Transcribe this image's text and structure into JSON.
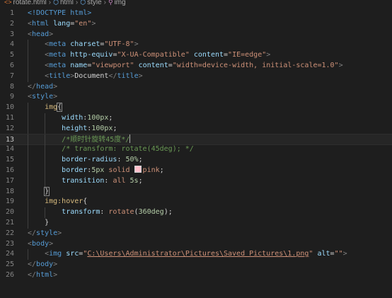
{
  "breadcrumb": [
    "rotate.html",
    "html",
    "style",
    "img"
  ],
  "lines": [
    {
      "n": "1",
      "tokens": [
        [
          "t-tag",
          "<!DOCTYPE html>"
        ]
      ]
    },
    {
      "n": "2",
      "tokens": [
        [
          "t-punc",
          "<"
        ],
        [
          "t-tag",
          "html "
        ],
        [
          "t-attr",
          "lang"
        ],
        [
          "t-txt",
          "="
        ],
        [
          "t-str",
          "\"en\""
        ],
        [
          "t-punc",
          ">"
        ]
      ]
    },
    {
      "n": "3",
      "tokens": [
        [
          "t-punc",
          "<"
        ],
        [
          "t-tag",
          "head"
        ],
        [
          "t-punc",
          ">"
        ]
      ]
    },
    {
      "n": "4",
      "indent": 2,
      "tokens": [
        [
          "t-punc",
          "<"
        ],
        [
          "t-tag",
          "meta "
        ],
        [
          "t-attr",
          "charset"
        ],
        [
          "t-txt",
          "="
        ],
        [
          "t-str",
          "\"UTF-8\""
        ],
        [
          "t-punc",
          ">"
        ]
      ]
    },
    {
      "n": "5",
      "indent": 2,
      "tokens": [
        [
          "t-punc",
          "<"
        ],
        [
          "t-tag",
          "meta "
        ],
        [
          "t-attr",
          "http-equiv"
        ],
        [
          "t-txt",
          "="
        ],
        [
          "t-str",
          "\"X-UA-Compatible\" "
        ],
        [
          "t-attr",
          "content"
        ],
        [
          "t-txt",
          "="
        ],
        [
          "t-str",
          "\"IE=edge\""
        ],
        [
          "t-punc",
          ">"
        ]
      ]
    },
    {
      "n": "6",
      "indent": 2,
      "tokens": [
        [
          "t-punc",
          "<"
        ],
        [
          "t-tag",
          "meta "
        ],
        [
          "t-attr",
          "name"
        ],
        [
          "t-txt",
          "="
        ],
        [
          "t-str",
          "\"viewport\" "
        ],
        [
          "t-attr",
          "content"
        ],
        [
          "t-txt",
          "="
        ],
        [
          "t-str",
          "\"width=device-width, initial-scale=1.0\""
        ],
        [
          "t-punc",
          ">"
        ]
      ]
    },
    {
      "n": "7",
      "indent": 2,
      "tokens": [
        [
          "t-punc",
          "<"
        ],
        [
          "t-tag",
          "title"
        ],
        [
          "t-punc",
          ">"
        ],
        [
          "t-txt",
          "Document"
        ],
        [
          "t-punc",
          "</"
        ],
        [
          "t-tag",
          "title"
        ],
        [
          "t-punc",
          ">"
        ]
      ]
    },
    {
      "n": "8",
      "tokens": [
        [
          "t-punc",
          "</"
        ],
        [
          "t-tag",
          "head"
        ],
        [
          "t-punc",
          ">"
        ]
      ]
    },
    {
      "n": "9",
      "tokens": [
        [
          "t-punc",
          "<"
        ],
        [
          "t-tag",
          "style"
        ],
        [
          "t-punc",
          ">"
        ]
      ]
    },
    {
      "n": "10",
      "indent": 2,
      "tokens": [
        [
          "t-sel",
          "img"
        ],
        [
          "t-brk-hl",
          "{"
        ]
      ]
    },
    {
      "n": "11",
      "indent": 4,
      "tokens": [
        [
          "t-prop",
          "width"
        ],
        [
          "t-txt",
          ":"
        ],
        [
          "t-num",
          "100px"
        ],
        [
          "t-txt",
          ";"
        ]
      ]
    },
    {
      "n": "12",
      "indent": 4,
      "tokens": [
        [
          "t-prop",
          "height"
        ],
        [
          "t-txt",
          ":"
        ],
        [
          "t-num",
          "100px"
        ],
        [
          "t-txt",
          ";"
        ]
      ]
    },
    {
      "n": "13",
      "indent": 4,
      "active": true,
      "tokens": [
        [
          "t-com",
          "/*顺时针旋转45度*/"
        ],
        [
          "cursor",
          ""
        ]
      ]
    },
    {
      "n": "14",
      "indent": 4,
      "tokens": [
        [
          "t-com",
          "/* transform: rotate(45deg); */"
        ]
      ]
    },
    {
      "n": "15",
      "indent": 4,
      "tokens": [
        [
          "t-prop",
          "border-radius"
        ],
        [
          "t-txt",
          ": "
        ],
        [
          "t-num",
          "50%"
        ],
        [
          "t-txt",
          ";"
        ]
      ]
    },
    {
      "n": "16",
      "indent": 4,
      "tokens": [
        [
          "t-prop",
          "border"
        ],
        [
          "t-txt",
          ":"
        ],
        [
          "t-num",
          "5px "
        ],
        [
          "t-val",
          "solid "
        ],
        [
          "swatch",
          ""
        ],
        [
          "t-val",
          "pink"
        ],
        [
          "t-txt",
          ";"
        ]
      ]
    },
    {
      "n": "17",
      "indent": 4,
      "tokens": [
        [
          "t-prop",
          "transition"
        ],
        [
          "t-txt",
          ": "
        ],
        [
          "t-val",
          "all "
        ],
        [
          "t-num",
          "5s"
        ],
        [
          "t-txt",
          ";"
        ]
      ]
    },
    {
      "n": "18",
      "indent": 2,
      "tokens": [
        [
          "t-brk-hl",
          "}"
        ]
      ]
    },
    {
      "n": "19",
      "indent": 2,
      "tokens": [
        [
          "t-sel",
          "img:hover"
        ],
        [
          "t-txt",
          "{"
        ]
      ]
    },
    {
      "n": "20",
      "indent": 4,
      "tokens": [
        [
          "t-prop",
          "transform"
        ],
        [
          "t-txt",
          ": "
        ],
        [
          "t-val",
          "rotate"
        ],
        [
          "t-txt",
          "("
        ],
        [
          "t-num",
          "360deg"
        ],
        [
          "t-txt",
          ");"
        ]
      ]
    },
    {
      "n": "21",
      "indent": 2,
      "tokens": [
        [
          "t-txt",
          "}"
        ]
      ]
    },
    {
      "n": "22",
      "tokens": [
        [
          "t-punc",
          "</"
        ],
        [
          "t-tag",
          "style"
        ],
        [
          "t-punc",
          ">"
        ]
      ]
    },
    {
      "n": "23",
      "tokens": [
        [
          "t-punc",
          "<"
        ],
        [
          "t-tag",
          "body"
        ],
        [
          "t-punc",
          ">"
        ]
      ]
    },
    {
      "n": "24",
      "indent": 2,
      "tokens": [
        [
          "t-punc",
          "<"
        ],
        [
          "t-tag",
          "img "
        ],
        [
          "t-attr",
          "src"
        ],
        [
          "t-txt",
          "="
        ],
        [
          "t-str",
          "\""
        ],
        [
          "t-url",
          "C:\\Users\\Administrator\\Pictures\\Saved Pictures\\1.png"
        ],
        [
          "t-str",
          "\" "
        ],
        [
          "t-attr",
          "alt"
        ],
        [
          "t-txt",
          "="
        ],
        [
          "t-str",
          "\"\""
        ],
        [
          "t-punc",
          ">"
        ]
      ]
    },
    {
      "n": "25",
      "tokens": [
        [
          "t-punc",
          "</"
        ],
        [
          "t-tag",
          "body"
        ],
        [
          "t-punc",
          ">"
        ]
      ]
    },
    {
      "n": "26",
      "tokens": [
        [
          "t-punc",
          "</"
        ],
        [
          "t-tag",
          "html"
        ],
        [
          "t-punc",
          ">"
        ]
      ]
    }
  ]
}
